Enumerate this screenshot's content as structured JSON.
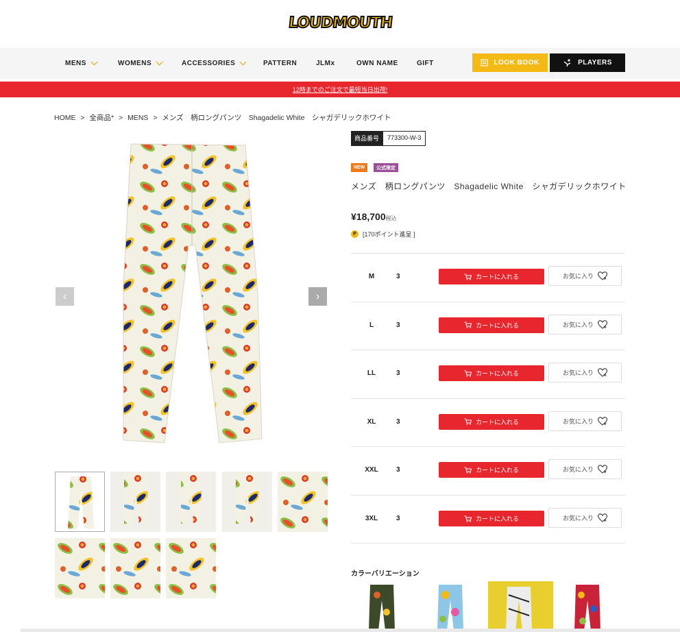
{
  "logo": {
    "text": "LOUDMOUTH"
  },
  "nav": {
    "items": [
      {
        "label": "MENS",
        "dropdown": true
      },
      {
        "label": "WOMENS",
        "dropdown": true
      },
      {
        "label": "ACCESSORIES",
        "dropdown": true
      },
      {
        "label": "PATTERN",
        "dropdown": false
      },
      {
        "label": "JLMx",
        "dropdown": false
      },
      {
        "label": "OWN NAME",
        "dropdown": false
      },
      {
        "label": "GIFT",
        "dropdown": false
      }
    ],
    "lookbook": "LOOK BOOK",
    "players": "PLAYERS"
  },
  "banner": "12時までのご注文で最短当日出荷!",
  "breadcrumb": [
    "HOME",
    ">",
    "全商品*",
    ">",
    "MENS",
    ">",
    "メンズ　柄ロングパンツ　Shagadelic White　シャガデリックホワイト"
  ],
  "product": {
    "sku_label": "商品番号",
    "sku": "773300-W-3",
    "badge_new": "NEW",
    "badge_official": "公式限定",
    "title": "メンズ　柄ロングパンツ　Shagadelic White　シャガデリックホワイト",
    "price": "¥18,700",
    "tax": "税込",
    "points": "[170ポイント進呈 ]",
    "point_icon": "P"
  },
  "sizes": [
    {
      "size": "M",
      "qty": "3",
      "cart": "カートに入れる",
      "fav": "お気に入り"
    },
    {
      "size": "L",
      "qty": "3",
      "cart": "カートに入れる",
      "fav": "お気に入り"
    },
    {
      "size": "LL",
      "qty": "3",
      "cart": "カートに入れる",
      "fav": "お気に入り"
    },
    {
      "size": "XL",
      "qty": "3",
      "cart": "カートに入れる",
      "fav": "お気に入り"
    },
    {
      "size": "XXL",
      "qty": "3",
      "cart": "カートに入れる",
      "fav": "お気に入り"
    },
    {
      "size": "3XL",
      "qty": "3",
      "cart": "カートに入れる",
      "fav": "お気に入り"
    }
  ],
  "color_variation_title": "カラーバリエーション",
  "colors": {
    "accent": "#f5b916",
    "red": "#e8262e",
    "dark": "#111111"
  }
}
